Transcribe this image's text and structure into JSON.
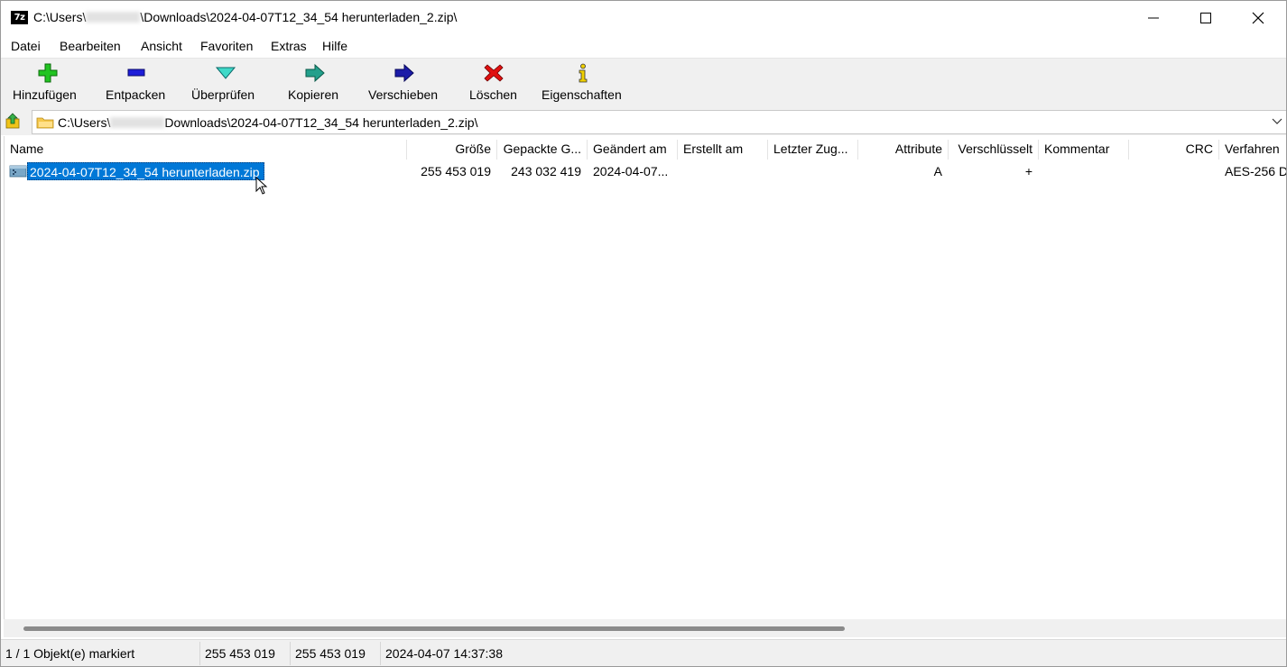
{
  "window": {
    "app_icon_text": "7z",
    "title_prefix": "C:\\Users\\",
    "title_suffix": "\\Downloads\\2024-04-07T12_34_54 herunterladen_2.zip\\"
  },
  "menu": [
    "Datei",
    "Bearbeiten",
    "Ansicht",
    "Favoriten",
    "Extras",
    "Hilfe"
  ],
  "toolbar": {
    "add": "Hinzufügen",
    "extract": "Entpacken",
    "test": "Überprüfen",
    "copy": "Kopieren",
    "move": "Verschieben",
    "delete": "Löschen",
    "info": "Eigenschaften"
  },
  "address": {
    "prefix": "C:\\Users\\",
    "suffix": "Downloads\\2024-04-07T12_34_54 herunterladen_2.zip\\"
  },
  "columns": [
    "Name",
    "Größe",
    "Gepackte G...",
    "Geändert am",
    "Erstellt am",
    "Letzter Zug...",
    "Attribute",
    "Verschlüsselt",
    "Kommentar",
    "CRC",
    "Verfahren"
  ],
  "rows": [
    {
      "name": "2024-04-07T12_34_54 herunterladen.zip",
      "size": "255 453 019",
      "packed": "243 032 419",
      "modified": "2024-04-07...",
      "created": "",
      "accessed": "",
      "attributes": "A",
      "encrypted": "+",
      "comment": "",
      "crc": "",
      "method": "AES-256 D"
    }
  ],
  "status": {
    "selection": "1 / 1 Objekt(e) markiert",
    "size": "255 453 019",
    "packed": "255 453 019",
    "date": "2024-04-07 14:37:38"
  },
  "colors": {
    "selection": "#0078d7",
    "toolbar_bg": "#f0f0f0"
  }
}
